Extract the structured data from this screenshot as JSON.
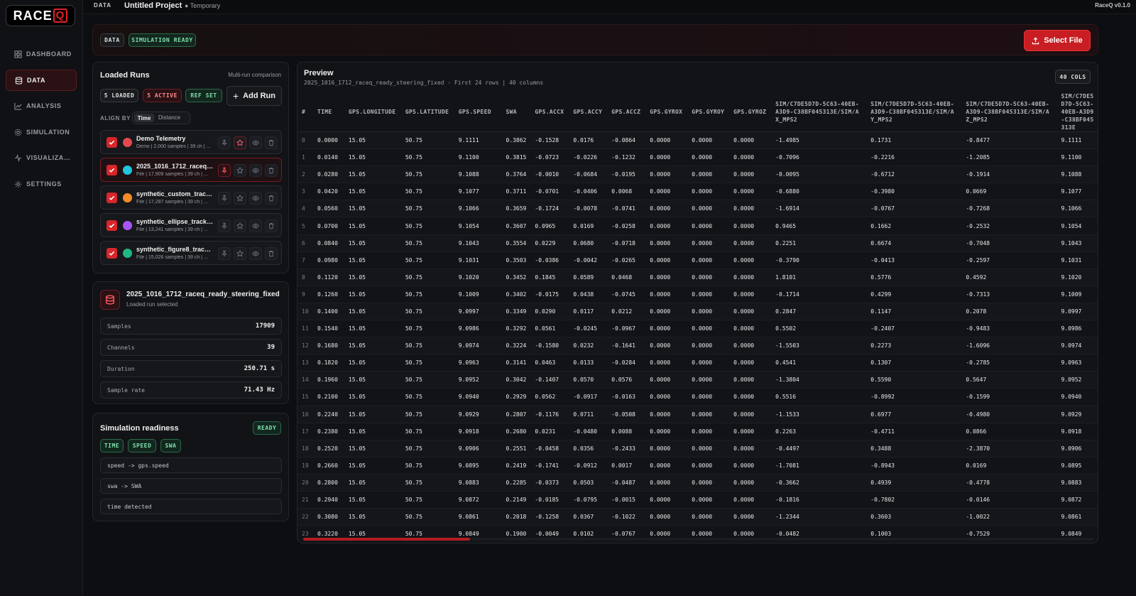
{
  "app": {
    "logo_text": "RACE",
    "logo_q": "Q",
    "version": "RaceQ v0.1.0"
  },
  "topbar": {
    "section": "DATA",
    "project": "Untitled Project",
    "status": "● Temporary"
  },
  "nav": [
    {
      "label": "DASHBOARD",
      "icon": "grid-icon",
      "active": false
    },
    {
      "label": "DATA",
      "icon": "database-icon",
      "active": true
    },
    {
      "label": "ANALYSIS",
      "icon": "chart-icon",
      "active": false
    },
    {
      "label": "SIMULATION",
      "icon": "gear-icon",
      "active": false
    },
    {
      "label": "VISUALIZA…",
      "icon": "pulse-icon",
      "active": false
    },
    {
      "label": "SETTINGS",
      "icon": "settings-icon",
      "active": false
    }
  ],
  "header": {
    "chip_data": "DATA",
    "chip_ready": "SIMULATION READY",
    "select_file": "Select File"
  },
  "runs": {
    "title": "Loaded Runs",
    "subtitle": "Multi-run comparison",
    "loaded": "5 LOADED",
    "active": "5 ACTIVE",
    "ref": "REF SET",
    "add": "Add Run",
    "align_by": "ALIGN BY",
    "align_time": "Time",
    "align_distance": "Distance",
    "items": [
      {
        "name": "Demo Telemetry",
        "meta": "Demo | 2,000 samples | 39 ch | ...",
        "color": "#e5484d",
        "selected": false,
        "pinned": false
      },
      {
        "name": "2025_1016_1712_raceq_r...",
        "meta": "File | 17,909 samples | 39 ch | ...",
        "color": "#22c5e0",
        "selected": true,
        "pinned": true
      },
      {
        "name": "synthetic_custom_track_...",
        "meta": "File | 17,287 samples | 39 ch | ...",
        "color": "#f28c28",
        "selected": false,
        "pinned": false
      },
      {
        "name": "synthetic_ellipse_track_r...",
        "meta": "File | 13,241 samples | 39 ch | ...",
        "color": "#a855f7",
        "selected": false,
        "pinned": false
      },
      {
        "name": "synthetic_figure8_track_...",
        "meta": "File | 15,026 samples | 39 ch | ...",
        "color": "#1fb784",
        "selected": false,
        "pinned": false
      }
    ]
  },
  "selected_run": {
    "name": "2025_1016_1712_raceq_ready_steering_fixed",
    "subtitle": "Loaded run selected",
    "stats": [
      {
        "key": "Samples",
        "value": "17909"
      },
      {
        "key": "Channels",
        "value": "39"
      },
      {
        "key": "Duration",
        "value": "250.71 s"
      },
      {
        "key": "Sample rate",
        "value": "71.43 Hz"
      }
    ]
  },
  "readiness": {
    "title": "Simulation readiness",
    "badge": "READY",
    "tags": [
      "TIME",
      "SPEED",
      "SWA"
    ],
    "mappings": [
      "speed -> gps.speed",
      "swa -> SWA",
      "time detected"
    ]
  },
  "preview": {
    "title": "Preview",
    "subtitle": "2025_1016_1712_raceq_ready_steering_fixed - First 24 rows | 40 columns",
    "cols_badge": "40 COLS",
    "columns": [
      "#",
      "TIME",
      "GPS.LONGITUDE",
      "GPS.LATITUDE",
      "GPS.SPEED",
      "SWA",
      "GPS.ACCX",
      "GPS.ACCY",
      "GPS.ACCZ",
      "GPS.GYROX",
      "GPS.GYROY",
      "GPS.GYROZ",
      "SIM/C7DE5D7D-5C63-40EB-A3D9-C38BF045313E/SIM/AX_MPS2",
      "SIM/C7DE5D7D-5C63-40EB-A3D9-C38BF045313E/SIM/AY_MPS2",
      "SIM/C7DE5D7D-5C63-40EB-A3D9-C38BF045313E/SIM/AZ_MPS2",
      "SIM/C7DE5D7D-5C63-40EB-A3D9-C38BF045313E"
    ],
    "rows": [
      [
        "0",
        "0.0000",
        "15.05",
        "50.75",
        "9.1111",
        "0.3862",
        "-0.1528",
        "0.0176",
        "-0.0864",
        "0.0000",
        "0.0000",
        "0.0000",
        "-1.4985",
        "0.1731",
        "-0.8477",
        "9.1111"
      ],
      [
        "1",
        "0.0140",
        "15.05",
        "50.75",
        "9.1100",
        "0.3815",
        "-0.0723",
        "-0.0226",
        "-0.1232",
        "0.0000",
        "0.0000",
        "0.0000",
        "-0.7096",
        "-0.2216",
        "-1.2085",
        "9.1100"
      ],
      [
        "2",
        "0.0280",
        "15.05",
        "50.75",
        "9.1088",
        "0.3764",
        "-0.0010",
        "-0.0684",
        "-0.0195",
        "0.0000",
        "0.0000",
        "0.0000",
        "-0.0095",
        "-0.6712",
        "-0.1914",
        "9.1088"
      ],
      [
        "3",
        "0.0420",
        "15.05",
        "50.75",
        "9.1077",
        "0.3711",
        "-0.0701",
        "-0.0406",
        "0.0068",
        "0.0000",
        "0.0000",
        "0.0000",
        "-0.6880",
        "-0.3980",
        "0.0669",
        "9.1077"
      ],
      [
        "4",
        "0.0560",
        "15.05",
        "50.75",
        "9.1066",
        "0.3659",
        "-0.1724",
        "-0.0078",
        "-0.0741",
        "0.0000",
        "0.0000",
        "0.0000",
        "-1.6914",
        "-0.0767",
        "-0.7268",
        "9.1066"
      ],
      [
        "5",
        "0.0700",
        "15.05",
        "50.75",
        "9.1054",
        "0.3607",
        "0.0965",
        "0.0169",
        "-0.0258",
        "0.0000",
        "0.0000",
        "0.0000",
        "0.9465",
        "0.1662",
        "-0.2532",
        "9.1054"
      ],
      [
        "6",
        "0.0840",
        "15.05",
        "50.75",
        "9.1043",
        "0.3554",
        "0.0229",
        "0.0680",
        "-0.0718",
        "0.0000",
        "0.0000",
        "0.0000",
        "0.2251",
        "0.6674",
        "-0.7048",
        "9.1043"
      ],
      [
        "7",
        "0.0980",
        "15.05",
        "50.75",
        "9.1031",
        "0.3503",
        "-0.0386",
        "-0.0042",
        "-0.0265",
        "0.0000",
        "0.0000",
        "0.0000",
        "-0.3790",
        "-0.0413",
        "-0.2597",
        "9.1031"
      ],
      [
        "8",
        "0.1120",
        "15.05",
        "50.75",
        "9.1020",
        "0.3452",
        "0.1845",
        "0.0589",
        "0.0468",
        "0.0000",
        "0.0000",
        "0.0000",
        "1.8101",
        "0.5776",
        "0.4592",
        "9.1020"
      ],
      [
        "9",
        "0.1260",
        "15.05",
        "50.75",
        "9.1009",
        "0.3402",
        "-0.0175",
        "0.0438",
        "-0.0745",
        "0.0000",
        "0.0000",
        "0.0000",
        "-0.1714",
        "0.4299",
        "-0.7313",
        "9.1009"
      ],
      [
        "10",
        "0.1400",
        "15.05",
        "50.75",
        "9.0997",
        "0.3349",
        "0.0290",
        "0.0117",
        "0.0212",
        "0.0000",
        "0.0000",
        "0.0000",
        "0.2847",
        "0.1147",
        "0.2078",
        "9.0997"
      ],
      [
        "11",
        "0.1540",
        "15.05",
        "50.75",
        "9.0986",
        "0.3292",
        "0.0561",
        "-0.0245",
        "-0.0967",
        "0.0000",
        "0.0000",
        "0.0000",
        "0.5502",
        "-0.2407",
        "-0.9483",
        "9.0986"
      ],
      [
        "12",
        "0.1680",
        "15.05",
        "50.75",
        "9.0974",
        "0.3224",
        "-0.1580",
        "0.0232",
        "-0.1641",
        "0.0000",
        "0.0000",
        "0.0000",
        "-1.5503",
        "0.2273",
        "-1.6096",
        "9.0974"
      ],
      [
        "13",
        "0.1820",
        "15.05",
        "50.75",
        "9.0963",
        "0.3141",
        "0.0463",
        "0.0133",
        "-0.0284",
        "0.0000",
        "0.0000",
        "0.0000",
        "0.4541",
        "0.1307",
        "-0.2785",
        "9.0963"
      ],
      [
        "14",
        "0.1960",
        "15.05",
        "50.75",
        "9.0952",
        "0.3042",
        "-0.1407",
        "0.0570",
        "0.0576",
        "0.0000",
        "0.0000",
        "0.0000",
        "-1.3804",
        "0.5590",
        "0.5647",
        "9.0952"
      ],
      [
        "15",
        "0.2100",
        "15.05",
        "50.75",
        "9.0940",
        "0.2929",
        "0.0562",
        "-0.0917",
        "-0.0163",
        "0.0000",
        "0.0000",
        "0.0000",
        "0.5516",
        "-0.8992",
        "-0.1599",
        "9.0940"
      ],
      [
        "16",
        "0.2240",
        "15.05",
        "50.75",
        "9.0929",
        "0.2807",
        "-0.1176",
        "0.0711",
        "-0.0508",
        "0.0000",
        "0.0000",
        "0.0000",
        "-1.1533",
        "0.6977",
        "-0.4980",
        "9.0929"
      ],
      [
        "17",
        "0.2380",
        "15.05",
        "50.75",
        "9.0918",
        "0.2680",
        "0.0231",
        "-0.0480",
        "0.0088",
        "0.0000",
        "0.0000",
        "0.0000",
        "0.2263",
        "-0.4711",
        "0.0866",
        "9.0918"
      ],
      [
        "18",
        "0.2520",
        "15.05",
        "50.75",
        "9.0906",
        "0.2551",
        "-0.0458",
        "0.0356",
        "-0.2433",
        "0.0000",
        "0.0000",
        "0.0000",
        "-0.4497",
        "0.3488",
        "-2.3870",
        "9.0906"
      ],
      [
        "19",
        "0.2660",
        "15.05",
        "50.75",
        "9.0895",
        "0.2419",
        "-0.1741",
        "-0.0912",
        "0.0017",
        "0.0000",
        "0.0000",
        "0.0000",
        "-1.7081",
        "-0.8943",
        "0.0169",
        "9.0895"
      ],
      [
        "20",
        "0.2800",
        "15.05",
        "50.75",
        "9.0883",
        "0.2285",
        "-0.0373",
        "0.0503",
        "-0.0487",
        "0.0000",
        "0.0000",
        "0.0000",
        "-0.3662",
        "0.4939",
        "-0.4778",
        "9.0883"
      ],
      [
        "21",
        "0.2940",
        "15.05",
        "50.75",
        "9.0872",
        "0.2149",
        "-0.0185",
        "-0.0795",
        "-0.0015",
        "0.0000",
        "0.0000",
        "0.0000",
        "-0.1816",
        "-0.7802",
        "-0.0146",
        "9.0872"
      ],
      [
        "22",
        "0.3080",
        "15.05",
        "50.75",
        "9.0861",
        "0.2018",
        "-0.1258",
        "0.0367",
        "-0.1022",
        "0.0000",
        "0.0000",
        "0.0000",
        "-1.2344",
        "0.3603",
        "-1.0022",
        "9.0861"
      ],
      [
        "23",
        "0.3220",
        "15.05",
        "50.75",
        "9.0849",
        "0.1900",
        "-0.0049",
        "0.0102",
        "-0.0767",
        "0.0000",
        "0.0000",
        "0.0000",
        "-0.0482",
        "0.1003",
        "-0.7529",
        "9.0849"
      ]
    ]
  },
  "colors": {
    "accent": "#c81e23",
    "green": "#2fbf7a",
    "bg": "#0d0e11"
  }
}
